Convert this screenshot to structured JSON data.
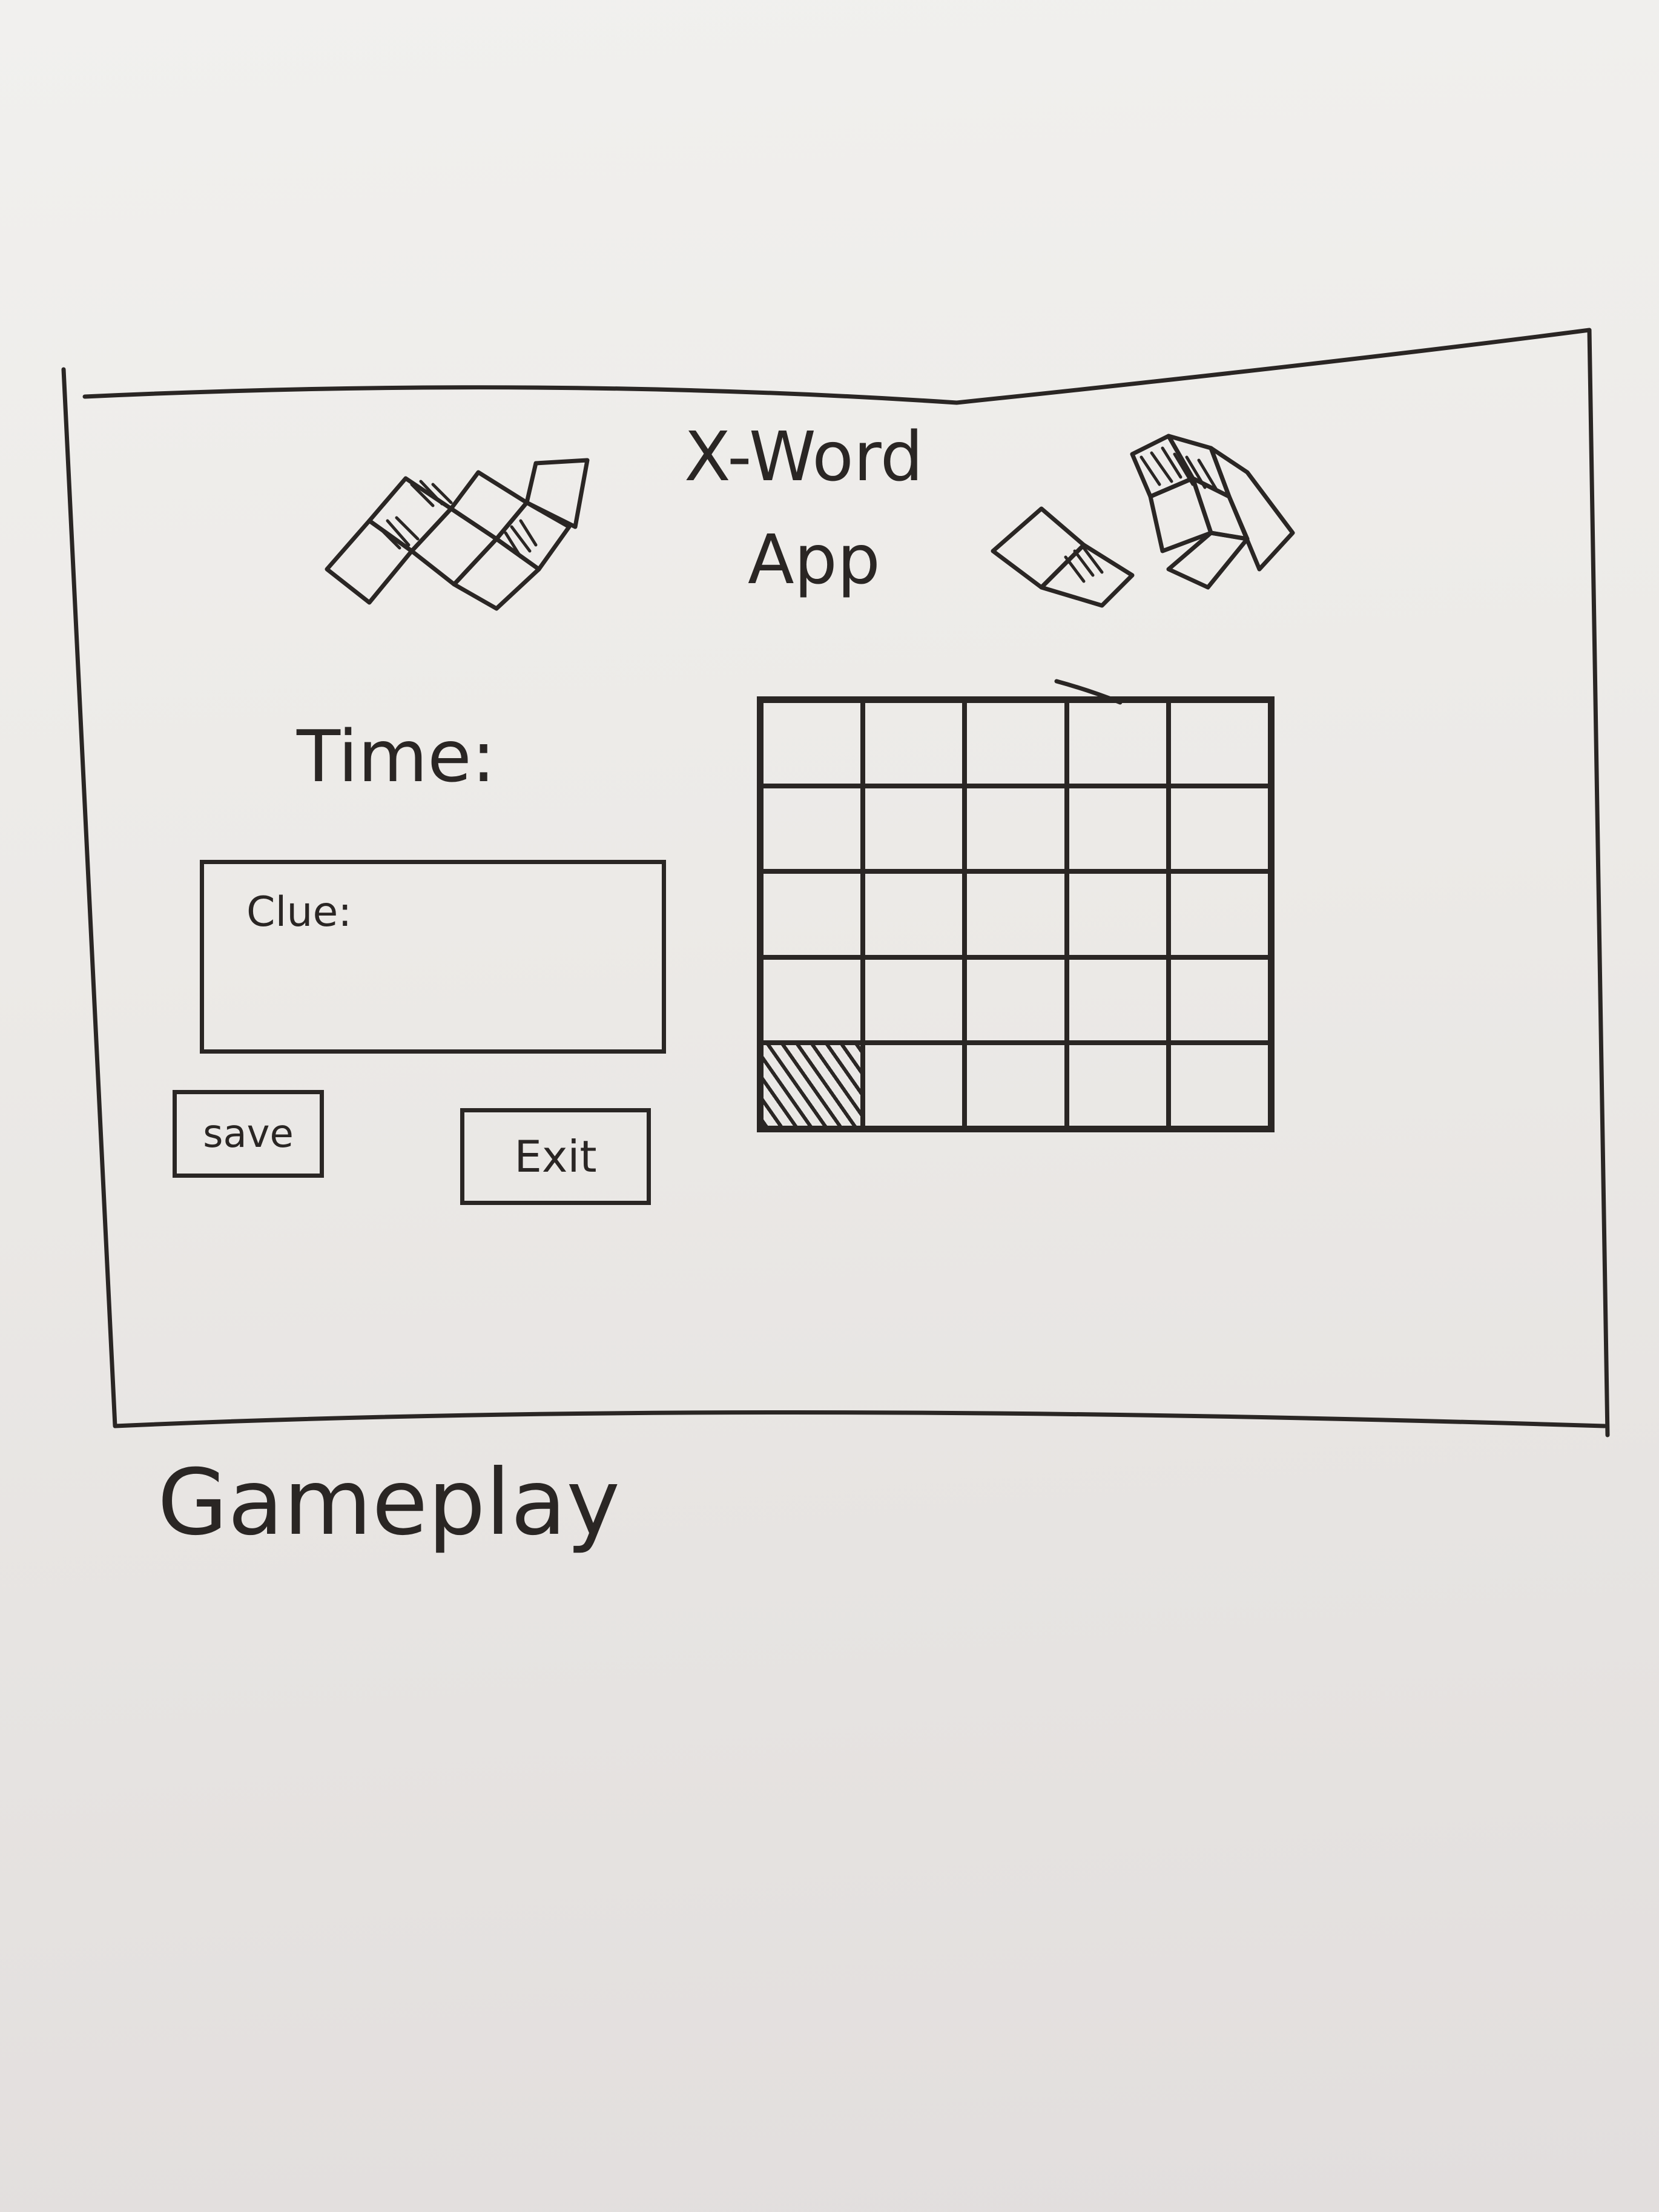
{
  "app": {
    "title_line1": "X-Word",
    "title_line2": "App"
  },
  "timer": {
    "label": "Time:"
  },
  "clue": {
    "label": "Clue:"
  },
  "buttons": {
    "save_label": "save",
    "exit_label": "Exit"
  },
  "grid": {
    "rows": 5,
    "cols": 5,
    "black_cells": [
      [
        4,
        0
      ]
    ]
  },
  "caption": "Gameplay"
}
